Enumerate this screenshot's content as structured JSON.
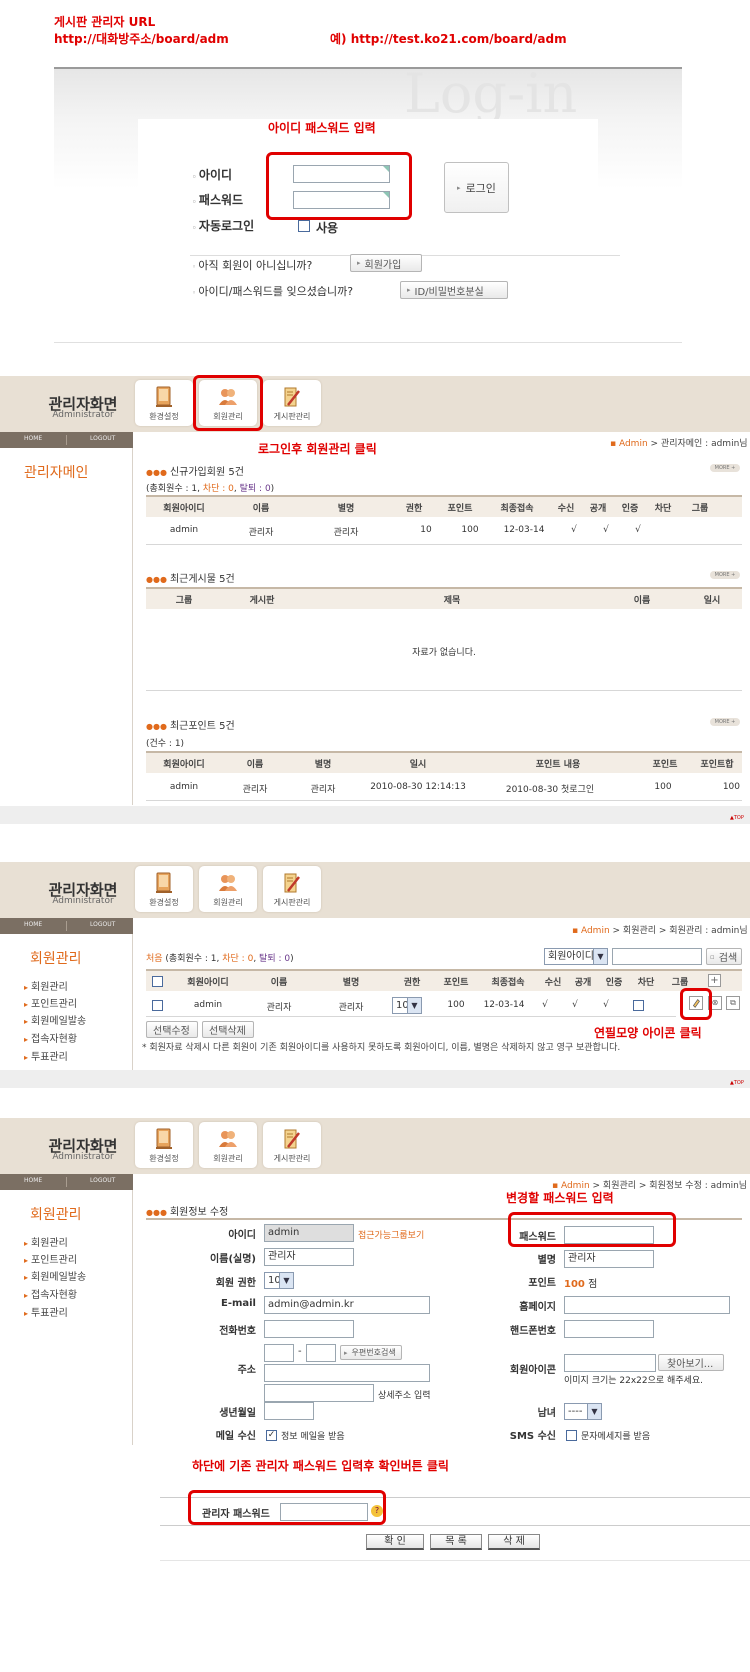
{
  "header_notes": {
    "line1": "게시판 관리자  URL",
    "line2": "http://대화방주소/board/adm",
    "example": "예) http://test.ko21.com/board/adm"
  },
  "login": {
    "bg_text": "Log-in",
    "hint": "아이디 패스워드 입력",
    "id_label": "아이디",
    "pw_label": "패스워드",
    "auto_label": "자동로그인",
    "auto_use": "사용",
    "login_button": "로그인",
    "not_member": "아직 회원이 아니십니까?",
    "join_button": "회원가입",
    "forgot": "아이디/패스워드를 잊으셨습니까?",
    "find_button": "ID/비밀번호분실"
  },
  "admin_header": {
    "title": "관리자화면",
    "subtitle": "Administrator",
    "nav": [
      "환경설정",
      "회원관리",
      "게시판관리"
    ],
    "home": "HOME",
    "logout": "LOGOUT",
    "top": "▲TOP"
  },
  "panel1": {
    "hint": "로그인후 회원관리 클릭",
    "crumb_admin": "Admin",
    "crumb_rest": " > 관리자메인 : admin님",
    "sidebar_title": "관리자메인",
    "more": "MORE +",
    "new_members": {
      "title": "신규가입회원 5건",
      "summary_pre": "(총회원수 : 1, ",
      "summary_block": "차단 : 0",
      "summary_sep": ", ",
      "summary_leave": "탈퇴 : 0",
      "summary_post": ")",
      "columns": [
        "회원아이디",
        "이름",
        "별명",
        "권한",
        "포인트",
        "최종접속",
        "수신",
        "공개",
        "인증",
        "차단",
        "그룹"
      ],
      "row": [
        "admin",
        "관리자",
        "관리자",
        "10",
        "100",
        "12-03-14",
        "√",
        "√",
        "√",
        "",
        ""
      ]
    },
    "recent_posts": {
      "title": "최근게시물 5건",
      "columns": [
        "그룹",
        "게시판",
        "제목",
        "이름",
        "일시"
      ],
      "empty": "자료가 없습니다."
    },
    "recent_points": {
      "title": "최근포인트 5건",
      "count": "(건수 : 1)",
      "columns": [
        "회원아이디",
        "이름",
        "별명",
        "일시",
        "포인트 내용",
        "포인트",
        "포인트합"
      ],
      "row": [
        "admin",
        "관리자",
        "관리자",
        "2010-08-30 12:14:13",
        "2010-08-30 첫로그인",
        "100",
        "100"
      ]
    }
  },
  "panel2": {
    "crumb_admin": "Admin",
    "crumb_rest": " > 회원관리 > 회원관리 : admin님",
    "sidebar_title": "회원관리",
    "menu": [
      "회원관리",
      "포인트관리",
      "회원메일발송",
      "접속자현황",
      "투표관리"
    ],
    "summary_first": "처음",
    "summary_pre": " (총회원수 : 1, ",
    "summary_block": "차단 : 0",
    "summary_sep": ", ",
    "summary_leave": "탈퇴 : 0",
    "summary_post": ")",
    "search_select": "회원아이디",
    "search_button": "검색",
    "columns": [
      "회원아이디",
      "이름",
      "별명",
      "권한",
      "포인트",
      "최종접속",
      "수신",
      "공개",
      "인증",
      "차단",
      "그룹"
    ],
    "row": [
      "admin",
      "관리자",
      "관리자",
      "10",
      "100",
      "12-03-14",
      "√",
      "√",
      "√",
      "",
      ""
    ],
    "edit_selected": "선택수정",
    "delete_selected": "선택삭제",
    "notice": "* 회원자료 삭제시 다른 회원이 기존 회원아이디를 사용하지 못하도록 회원아이디, 이름, 별명은 삭제하지 않고 영구 보관합니다.",
    "hint": "연필모양 아이콘 클릭"
  },
  "panel3": {
    "crumb_admin": "Admin",
    "crumb_rest": " > 회원관리 > 회원정보 수정 : admin님",
    "sidebar_title": "회원관리",
    "menu": [
      "회원관리",
      "포인트관리",
      "회원메일발송",
      "접속자현황",
      "투표관리"
    ],
    "section_title": "회원정보 수정",
    "hint_pw": "변경할 패스워드 입력",
    "labels": {
      "id": "아이디",
      "name": "이름(실명)",
      "level": "회원 권한",
      "email": "E-mail",
      "phone": "전화번호",
      "address": "주소",
      "birth": "생년월일",
      "mail_recv": "메일 수신",
      "password": "패스워드",
      "nick": "별명",
      "point": "포인트",
      "homepage": "홈페이지",
      "mobile": "핸드폰번호",
      "icon": "회원아이콘",
      "gender": "남녀",
      "sms_recv": "SMS 수신"
    },
    "values": {
      "id": "admin",
      "group_link": "접근가능그룹보기",
      "name": "관리자",
      "level": "10",
      "email": "admin@admin.kr",
      "nick": "관리자",
      "point": "100",
      "point_unit": "점",
      "zip_dash": "-",
      "zip_button": "우편번호검색",
      "addr_detail": "상세주소 입력",
      "browse": "찾아보기...",
      "icon_note": "이미지 크기는 22x22으로 해주세요.",
      "gender": "----",
      "mail_opt": "정보 메일을 받음",
      "sms_opt": "문자메세지를 받음"
    },
    "hint_admin": "하단에 기존 관리자 패스워드 입력후 확인버튼 클릭",
    "admin_pw_label": "관리자 패스워드",
    "buttons": [
      "확 인",
      "목 록",
      "삭 제"
    ]
  }
}
